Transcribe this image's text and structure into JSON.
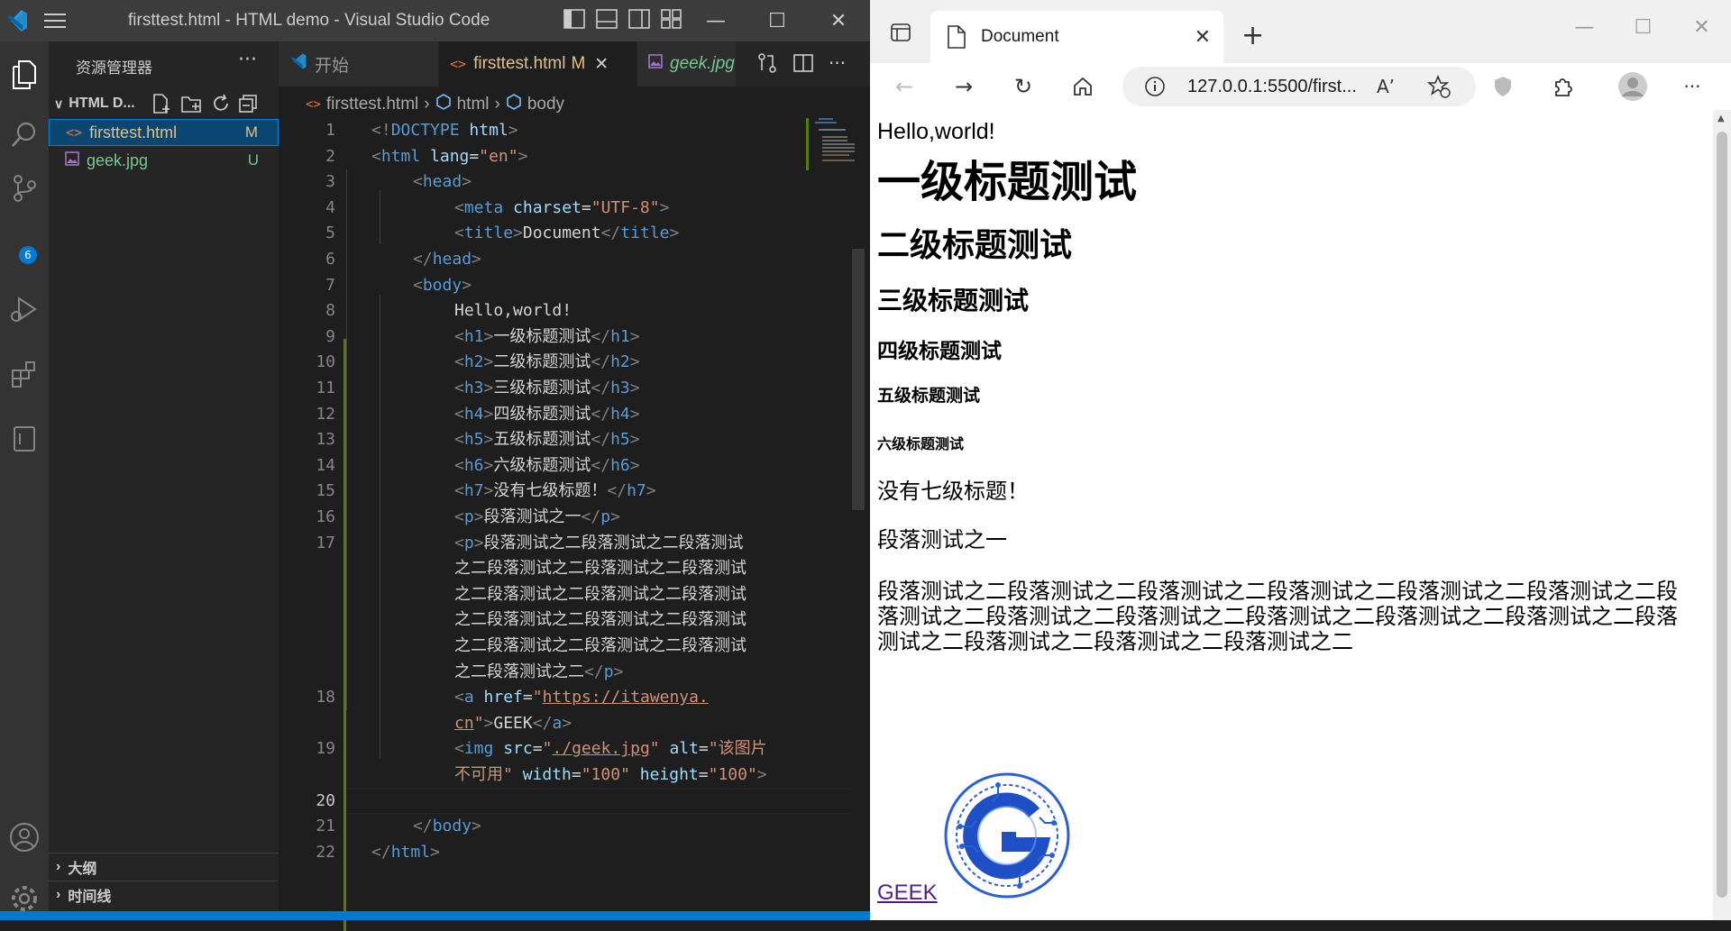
{
  "vscode": {
    "window_title": "firsttest.html - HTML demo - Visual Studio Code",
    "scm_badge": "6",
    "sidebar": {
      "title": "资源管理器",
      "more": "···",
      "folder": "HTML D...",
      "files": [
        {
          "name": "firsttest.html",
          "status": "M",
          "color": "#e2c08d",
          "icon": "html-file-icon"
        },
        {
          "name": "geek.jpg",
          "status": "U",
          "color": "#73c991",
          "icon": "image-file-icon"
        }
      ],
      "outline": "大纲",
      "timeline": "时间线"
    },
    "tabs": [
      {
        "label": "开始",
        "icon": "vscode-icon"
      },
      {
        "label": "firsttest.html",
        "status": "M"
      },
      {
        "label": "geek.jpg"
      }
    ],
    "breadcrumb": [
      "firsttest.html",
      "html",
      "body"
    ],
    "code_lines": [
      "1",
      "2",
      "3",
      "4",
      "5",
      "6",
      "7",
      "8",
      "9",
      "10",
      "11",
      "12",
      "13",
      "14",
      "15",
      "16",
      "17",
      "18",
      "19",
      "20",
      "21",
      "22"
    ]
  },
  "browser": {
    "tab_title": "Document",
    "url": "127.0.0.1:5500/first...",
    "page": {
      "text": "Hello,world!",
      "h1": "一级标题测试",
      "h2": "二级标题测试",
      "h3": "三级标题测试",
      "h4": "四级标题测试",
      "h5": "五级标题测试",
      "h6": "六级标题测试",
      "h7": "没有七级标题！",
      "p1": "段落测试之一",
      "p2_lines": [
        "段落测试之二段落测试之二段落测试之二段落测试之二段落测试之二段落测试之二段",
        "落测试之二段落测试之二段落测试之二段落测试之二段落测试之二段落测试之二段落",
        "测试之二段落测试之二段落测试之二段落测试之二"
      ],
      "link": "GEEK"
    }
  }
}
